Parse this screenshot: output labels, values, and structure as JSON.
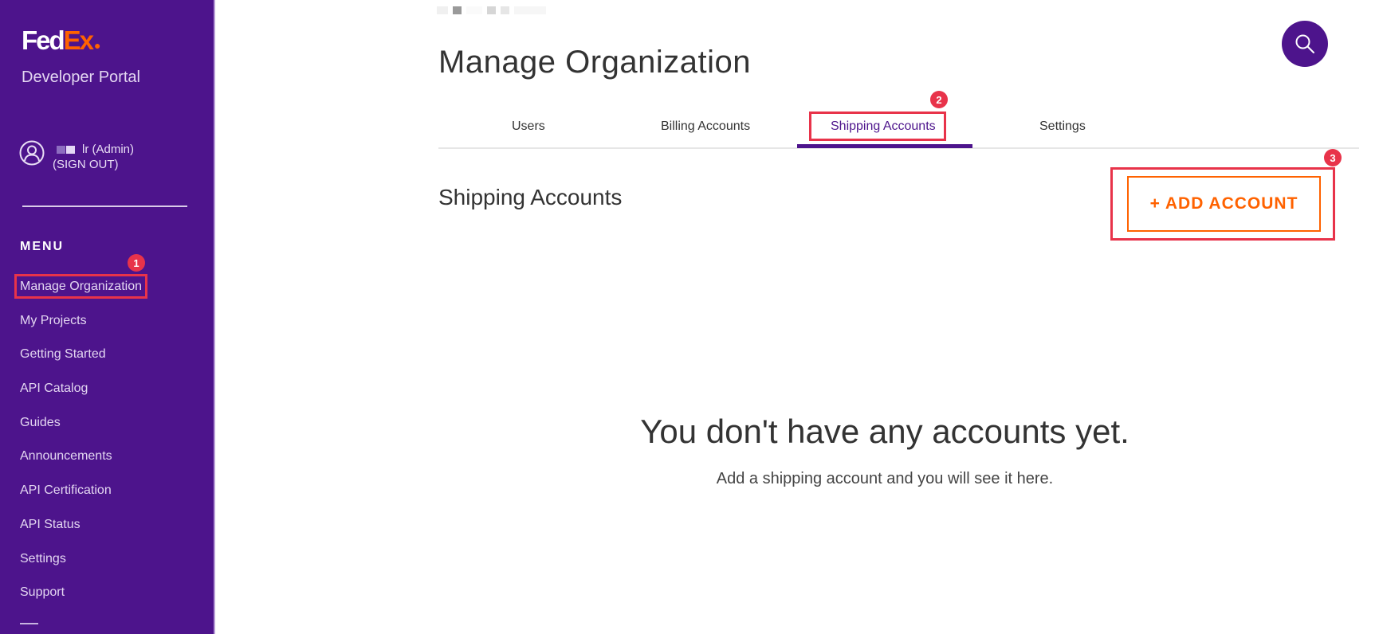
{
  "brand": {
    "logo_fed": "Fed",
    "logo_ex": "Ex",
    "logo_dot": "●",
    "portal_name": "Developer Portal",
    "colors": {
      "purple": "#4d148c",
      "orange": "#ff6200",
      "annotation_red": "#e8334a"
    }
  },
  "user": {
    "name_suffix": "lr (Admin)",
    "sign_out": "(SIGN OUT)"
  },
  "sidebar": {
    "menu_title": "MENU",
    "items": [
      {
        "label": "Manage Organization"
      },
      {
        "label": "My Projects"
      },
      {
        "label": "Getting Started"
      },
      {
        "label": "API Catalog"
      },
      {
        "label": "Guides"
      },
      {
        "label": "Announcements"
      },
      {
        "label": "API Certification"
      },
      {
        "label": "API Status"
      },
      {
        "label": "Settings"
      },
      {
        "label": "Support"
      }
    ]
  },
  "main": {
    "page_title": "Manage Organization",
    "tabs": [
      {
        "label": "Users"
      },
      {
        "label": "Billing Accounts"
      },
      {
        "label": "Shipping Accounts",
        "active": true
      },
      {
        "label": "Settings"
      }
    ],
    "section_title": "Shipping Accounts",
    "add_button": "+ ADD ACCOUNT",
    "empty_title": "You don't have any accounts yet.",
    "empty_subtitle": "Add a shipping account and you will see it here."
  },
  "annotations": [
    {
      "number": "1",
      "target": "Manage Organization"
    },
    {
      "number": "2",
      "target": "Shipping Accounts tab"
    },
    {
      "number": "3",
      "target": "+ ADD ACCOUNT"
    }
  ]
}
